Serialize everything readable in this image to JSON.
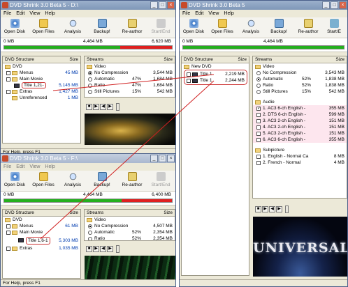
{
  "windows": {
    "tl": {
      "title": "DVD Shrink 3.0 Beta 5 - D:\\",
      "menu": [
        "File",
        "Edit",
        "View",
        "Help"
      ],
      "toolbar": [
        "Open Disk",
        "Open Files",
        "Analysis",
        "Backup!",
        "Re-author",
        "Start/End"
      ],
      "progress": {
        "left": "0 MB",
        "mid": "4,464 MB",
        "right": "6,620 MB"
      },
      "tree_header": {
        "name": "DVD Structure",
        "size": "Size"
      },
      "tree": [
        {
          "label": "DVD",
          "size": ""
        },
        {
          "label": "Menus",
          "size": "45 MB"
        },
        {
          "label": "Main Movie",
          "size": ""
        },
        {
          "label": "Title 1,21-",
          "size": "5,145 MB"
        },
        {
          "label": "Extras",
          "size": "1,427 MB"
        },
        {
          "label": "Unreferenced",
          "size": "1 MB"
        }
      ],
      "streams_header": {
        "name": "Streams",
        "size": "Size"
      },
      "video_label": "Video",
      "options": [
        {
          "label": "No Compression",
          "pct": "",
          "size": "3,544 MB"
        },
        {
          "label": "Automatic",
          "pct": "47%",
          "size": "1,684 MB"
        },
        {
          "label": "Ratio",
          "pct": "47%",
          "size": "1,684 MB"
        },
        {
          "label": "Still Pictures",
          "pct": "15%",
          "size": "542 MB"
        }
      ],
      "status": "For Help, press F1"
    },
    "bl": {
      "title": "DVD Shrink 3.0 Beta 5 - F:\\",
      "menu": [
        "File",
        "Edit",
        "View",
        "Help"
      ],
      "toolbar": [
        "Open Disk",
        "Open Files",
        "Analysis",
        "Backup!",
        "Re-author",
        "Start/End"
      ],
      "progress": {
        "left": "0 MB",
        "mid": "4,464 MB",
        "right": "6,400 MB"
      },
      "tree_header": {
        "name": "DVD Structure",
        "size": "Size"
      },
      "tree": [
        {
          "label": "DVD",
          "size": ""
        },
        {
          "label": "Menus",
          "size": "61 MB"
        },
        {
          "label": "Main Movie",
          "size": ""
        },
        {
          "label": "Title 1,6-1",
          "size": "5,303 MB"
        },
        {
          "label": "Extras",
          "size": "1,035 MB"
        }
      ],
      "streams_header": {
        "name": "Streams",
        "size": "Size"
      },
      "video_label": "Video",
      "options": [
        {
          "label": "No Compression",
          "pct": "",
          "size": "4,507 MB"
        },
        {
          "label": "Automatic",
          "pct": "52%",
          "size": "2,354 MB"
        },
        {
          "label": "Ratio",
          "pct": "52%",
          "size": "2,354 MB"
        }
      ],
      "status": "For Help, press F1"
    },
    "right": {
      "title": "DVD Shrink 3.0 Beta 5",
      "menu": [
        "File",
        "Edit",
        "View",
        "Help"
      ],
      "toolbar": [
        "Open Disk",
        "Open Files",
        "Analysis",
        "Backup!",
        "Re-author",
        "Start/E"
      ],
      "progress": {
        "left": "0 MB",
        "mid": "4,464 MB"
      },
      "tree_header": {
        "name": "DVD Structure",
        "size": "Size"
      },
      "tree": [
        {
          "label": "New DVD",
          "size": ""
        },
        {
          "label": "Title 1",
          "size": "2,219 MB"
        },
        {
          "label": "Title 1",
          "size": "2,244 MB"
        }
      ],
      "streams_header": {
        "name": "Streams",
        "size": "Size"
      },
      "video_label": "Video",
      "options": [
        {
          "label": "No Compression",
          "pct": "",
          "size": "3,543 MB"
        },
        {
          "label": "Automatic",
          "pct": "52%",
          "size": "1,838 MB"
        },
        {
          "label": "Ratio",
          "pct": "52%",
          "size": "1,838 MB"
        },
        {
          "label": "Still Pictures",
          "pct": "15%",
          "size": "542 MB"
        }
      ],
      "audio_label": "Audio",
      "audio": [
        {
          "label": "1. AC3 6-ch English -",
          "size": "355 MB"
        },
        {
          "label": "2. DTS 6-ch English -",
          "size": "599 MB"
        },
        {
          "label": "3. AC3 2-ch English -",
          "size": "151 MB"
        },
        {
          "label": "4. AC3 2-ch English -",
          "size": "151 MB"
        },
        {
          "label": "5. AC3 2-ch English -",
          "size": "151 MB"
        },
        {
          "label": "6. AC3 6-ch English -",
          "size": "355 MB"
        }
      ],
      "subpicture_label": "Subpicture",
      "subpicture": [
        {
          "label": "1. English - Normal Ca",
          "size": "8 MB"
        },
        {
          "label": "2. French - Normal",
          "size": "4 MB"
        }
      ],
      "preview_text": "UNIVERSAL"
    }
  }
}
